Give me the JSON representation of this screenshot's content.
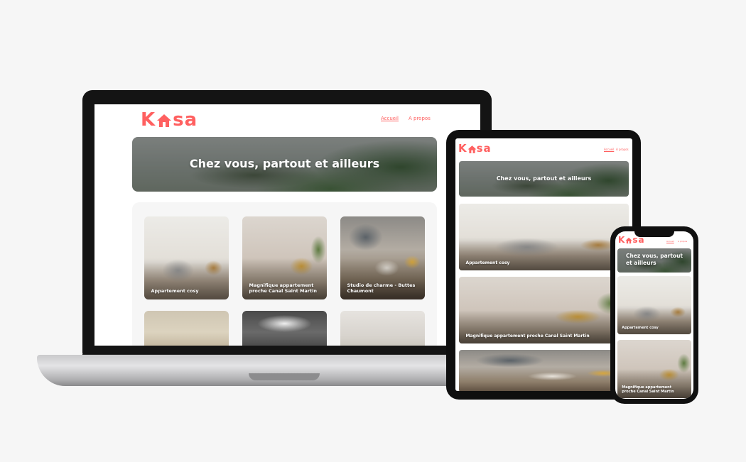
{
  "brand": {
    "logo_left": "K",
    "logo_right": "sa",
    "accent_color": "#ff6060"
  },
  "nav": {
    "home": "Accueil",
    "about": "A propos"
  },
  "banner": {
    "tagline": "Chez vous, partout et ailleurs"
  },
  "listings": [
    {
      "title": "Appartement cosy"
    },
    {
      "title": "Magnifique appartement proche Canal Saint Martin"
    },
    {
      "title": "Studio de charme - Buttes Chaumont"
    },
    {
      "title": ""
    },
    {
      "title": ""
    },
    {
      "title": ""
    }
  ],
  "icons": {
    "logo_house": "house-icon"
  }
}
